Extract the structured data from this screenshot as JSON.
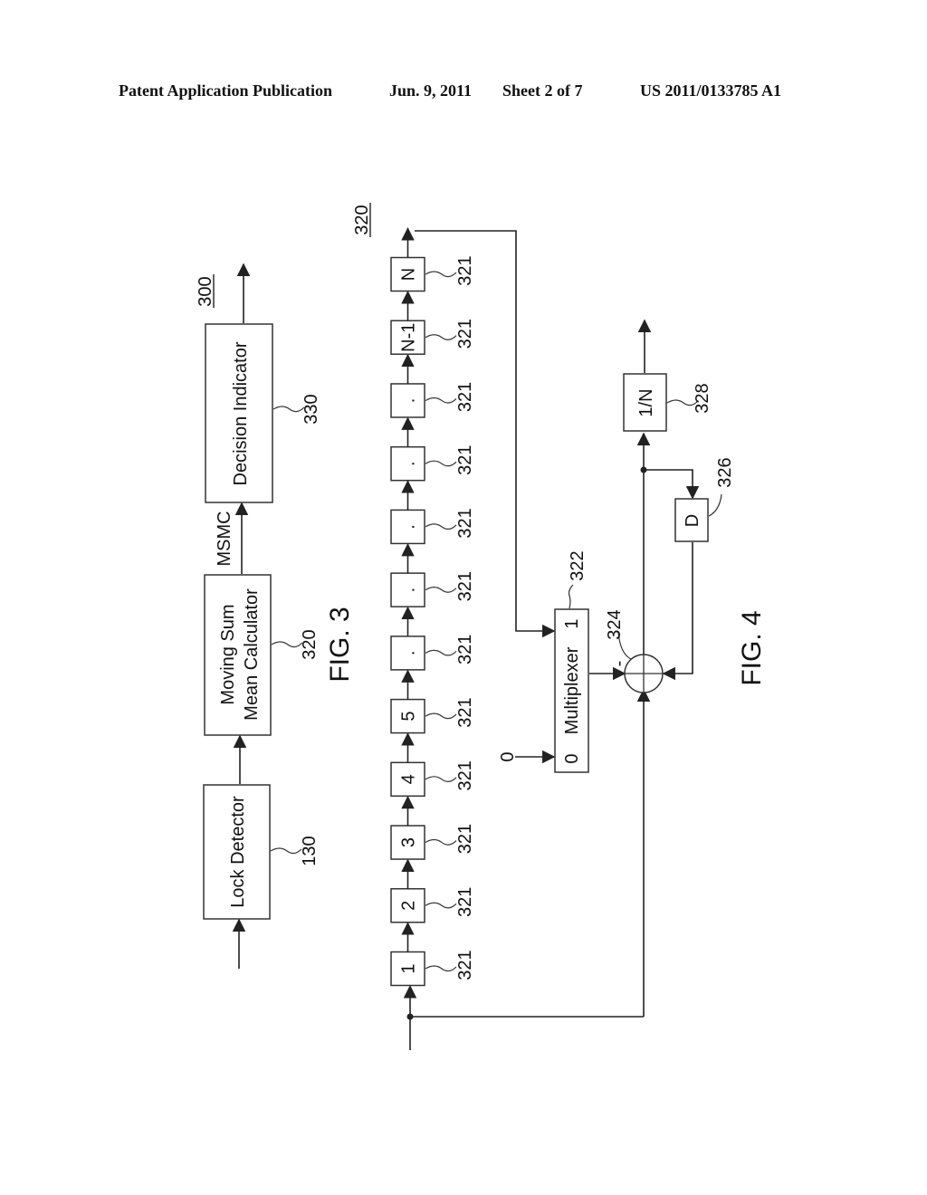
{
  "header": {
    "left": "Patent Application Publication",
    "date": "Jun. 9, 2011",
    "sheet": "Sheet 2 of 7",
    "number": "US 2011/0133785 A1"
  },
  "fig3": {
    "caption": "FIG. 3",
    "system_ref": "300",
    "signal_label": "MSMC",
    "blocks": [
      {
        "lines": [
          "Lock Detector"
        ],
        "ref": "130"
      },
      {
        "lines": [
          "Moving Sum",
          "Mean Calculator"
        ],
        "ref": "320"
      },
      {
        "lines": [
          "Decision Indicator"
        ],
        "ref": "330"
      }
    ]
  },
  "fig4": {
    "caption": "FIG. 4",
    "system_ref": "320",
    "delay_ref": "321",
    "delay_cells": [
      "1",
      "2",
      "3",
      "4",
      "5",
      ".",
      ".",
      ".",
      ".",
      ".",
      "N-1",
      "N"
    ],
    "multiplexer": {
      "label": "Multiplexer",
      "input0": "0",
      "input1": "1",
      "ref": "322",
      "zero_input": "0"
    },
    "adder": {
      "ref": "324",
      "minus_sign": "-"
    },
    "delay": {
      "label": "D",
      "ref": "326"
    },
    "scaler": {
      "label": "1/N",
      "ref": "328"
    }
  }
}
